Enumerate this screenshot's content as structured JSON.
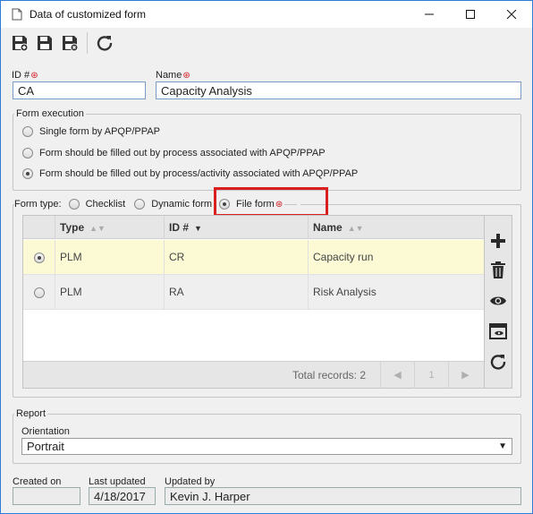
{
  "window": {
    "title": "Data of customized form",
    "icons": {
      "doc": "document-icon",
      "minimize": "minimize-icon",
      "maximize": "maximize-icon",
      "close": "close-icon"
    }
  },
  "toolbar": {
    "icons": [
      "save-new-icon",
      "save-icon",
      "save-close-icon",
      "refresh-icon"
    ]
  },
  "form": {
    "id_label": "ID #",
    "id_value": "CA",
    "name_label": "Name",
    "name_value": "Capacity Analysis",
    "required_mark": "⊛"
  },
  "form_execution": {
    "title": "Form execution",
    "options": [
      {
        "label": "Single form by APQP/PPAP",
        "selected": false
      },
      {
        "label": "Form should be filled out by process associated with APQP/PPAP",
        "selected": false
      },
      {
        "label": "Form should be filled out by process/activity associated with APQP/PPAP",
        "selected": true
      }
    ]
  },
  "form_type": {
    "label": "Form type:",
    "options": [
      {
        "label": "Checklist",
        "selected": false
      },
      {
        "label": "Dynamic form",
        "selected": false
      },
      {
        "label": "File form",
        "selected": true
      }
    ]
  },
  "grid": {
    "columns": [
      "Type",
      "ID #",
      "Name"
    ],
    "rows": [
      {
        "type": "PLM",
        "id": "CR",
        "name": "Capacity run",
        "selected": true
      },
      {
        "type": "PLM",
        "id": "RA",
        "name": "Risk Analysis",
        "selected": false
      }
    ],
    "total_records": "Total records: 2",
    "page": "1",
    "side_icons": [
      "add-icon",
      "delete-icon",
      "view-icon",
      "view-window-icon",
      "refresh-icon"
    ]
  },
  "report": {
    "title": "Report",
    "orientation_label": "Orientation",
    "orientation_value": "Portrait"
  },
  "footer": {
    "created_on_label": "Created on",
    "created_on_value": "",
    "last_updated_label": "Last updated",
    "last_updated_value": "4/18/2017",
    "updated_by_label": "Updated by",
    "updated_by_value": "Kevin J. Harper"
  },
  "colors": {
    "accent_border": "#2b7dd8",
    "highlight": "#d9201f",
    "required": "#d0161b",
    "selected_row": "#fcfad5"
  }
}
